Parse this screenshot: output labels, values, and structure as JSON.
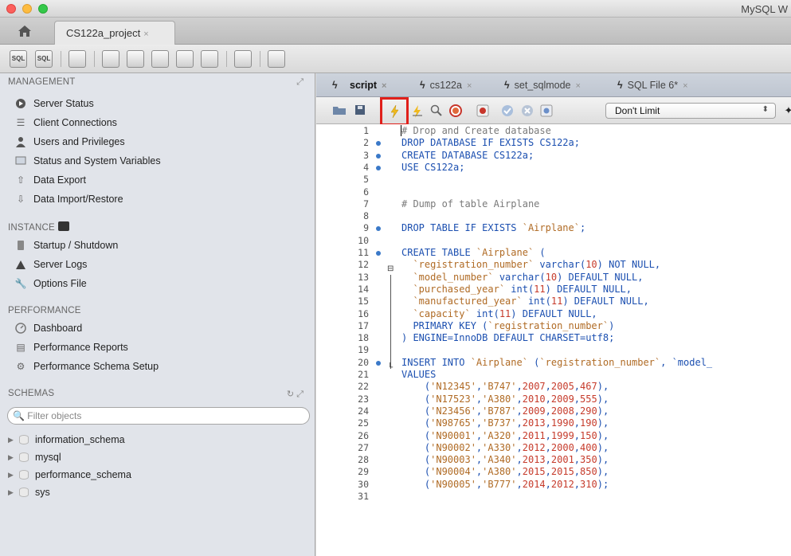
{
  "window": {
    "title": "MySQL W",
    "colors": {
      "close": "#fc605c",
      "minimize": "#fdbc40",
      "maximize": "#34c84a"
    }
  },
  "app_tabs": {
    "home_icon": "house-icon",
    "project_tab": "CS122a_project",
    "close_glyph": "×"
  },
  "main_toolbar": {
    "buttons": [
      "new-sql-tab-icon",
      "open-sql-script-icon",
      "inspector-icon",
      "create-schema-icon",
      "create-table-icon",
      "create-view-icon",
      "create-procedure-icon",
      "create-function-icon",
      "search-table-data-icon",
      "reconnect-icon"
    ],
    "sql_label": "SQL"
  },
  "sidebar": {
    "management": {
      "header": "MANAGEMENT",
      "items": [
        "Server Status",
        "Client Connections",
        "Users and Privileges",
        "Status and System Variables",
        "Data Export",
        "Data Import/Restore"
      ]
    },
    "instance": {
      "header": "INSTANCE",
      "items": [
        "Startup / Shutdown",
        "Server Logs",
        "Options File"
      ]
    },
    "performance": {
      "header": "PERFORMANCE",
      "items": [
        "Dashboard",
        "Performance Reports",
        "Performance Schema Setup"
      ]
    },
    "schemas": {
      "header": "SCHEMAS",
      "filter_placeholder": "Filter objects",
      "items": [
        "information_schema",
        "mysql",
        "performance_schema",
        "sys"
      ]
    }
  },
  "editor": {
    "tabs": [
      {
        "label": "script",
        "active": true
      },
      {
        "label": "cs122a",
        "active": false
      },
      {
        "label": "set_sqlmode",
        "active": false
      },
      {
        "label": "SQL File 6*",
        "active": false
      }
    ],
    "close_glyph": "×",
    "toolbar": {
      "limit_select": "Don't Limit",
      "highlighted_button": "execute-bolt-icon",
      "highlight_color": "#e0201b"
    },
    "line_numbers": [
      "1",
      "2",
      "3",
      "4",
      "5",
      "6",
      "7",
      "8",
      "9",
      "10",
      "11",
      "12",
      "13",
      "14",
      "15",
      "16",
      "17",
      "18",
      "19",
      "20",
      "21",
      "22",
      "23",
      "24",
      "25",
      "26",
      "27",
      "28",
      "29",
      "30",
      "31"
    ],
    "lines": [
      "# Drop and Create database",
      "DROP DATABASE IF EXISTS CS122a;",
      "CREATE DATABASE CS122a;",
      "USE CS122a;",
      "",
      "",
      "# Dump of table Airplane",
      "",
      "DROP TABLE IF EXISTS `Airplane`;",
      "",
      "CREATE TABLE `Airplane` (",
      "  `registration_number` varchar(10) NOT NULL,",
      "  `model_number` varchar(10) DEFAULT NULL,",
      "  `purchased_year` int(11) DEFAULT NULL,",
      "  `manufactured_year` int(11) DEFAULT NULL,",
      "  `capacity` int(11) DEFAULT NULL,",
      "  PRIMARY KEY (`registration_number`)",
      ") ENGINE=InnoDB DEFAULT CHARSET=utf8;",
      "",
      "INSERT INTO `Airplane` (`registration_number`, `model_",
      "VALUES",
      "    ('N12345','B747',2007,2005,467),",
      "    ('N17523','A380',2010,2009,555),",
      "    ('N23456','B787',2009,2008,290),",
      "    ('N98765','B737',2013,1990,190),",
      "    ('N90001','A320',2011,1999,150),",
      "    ('N90002','A330',2012,2000,400),",
      "    ('N90003','A340',2013,2001,350),",
      "    ('N90004','A380',2015,2015,850),",
      "    ('N90005','B777',2014,2012,310);",
      ""
    ],
    "statement_markers": [
      "2",
      "3",
      "4",
      "9",
      "11",
      "20"
    ],
    "syntax_colors": {
      "keyword": "#1b4fb0",
      "string": "#b06b25",
      "number": "#c63b2b",
      "comment": "#7a7a7a"
    }
  }
}
